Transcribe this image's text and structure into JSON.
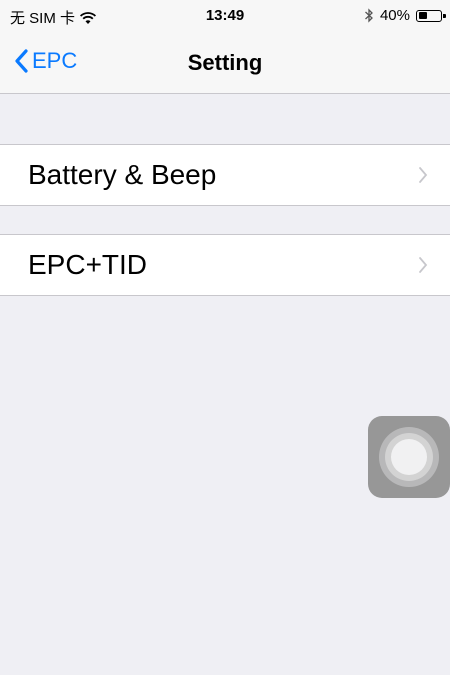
{
  "status_bar": {
    "carrier": "无 SIM 卡",
    "time": "13:49",
    "battery_text": "40%",
    "battery_level": 0.4
  },
  "nav": {
    "back_label": "EPC",
    "title": "Setting"
  },
  "settings": {
    "items": [
      {
        "label": "Battery & Beep"
      },
      {
        "label": "EPC+TID"
      }
    ]
  },
  "icons": {
    "back": "chevron-left-icon",
    "disclosure": "chevron-right-icon",
    "wifi": "wifi-icon",
    "bluetooth": "bluetooth-icon",
    "battery": "battery-icon",
    "assistive": "assistive-touch-icon"
  },
  "colors": {
    "accent": "#0a7aff",
    "background": "#efeff4",
    "bar": "#f7f7f7",
    "separator": "#c8c7cc",
    "chevron": "#c7c7cc"
  }
}
